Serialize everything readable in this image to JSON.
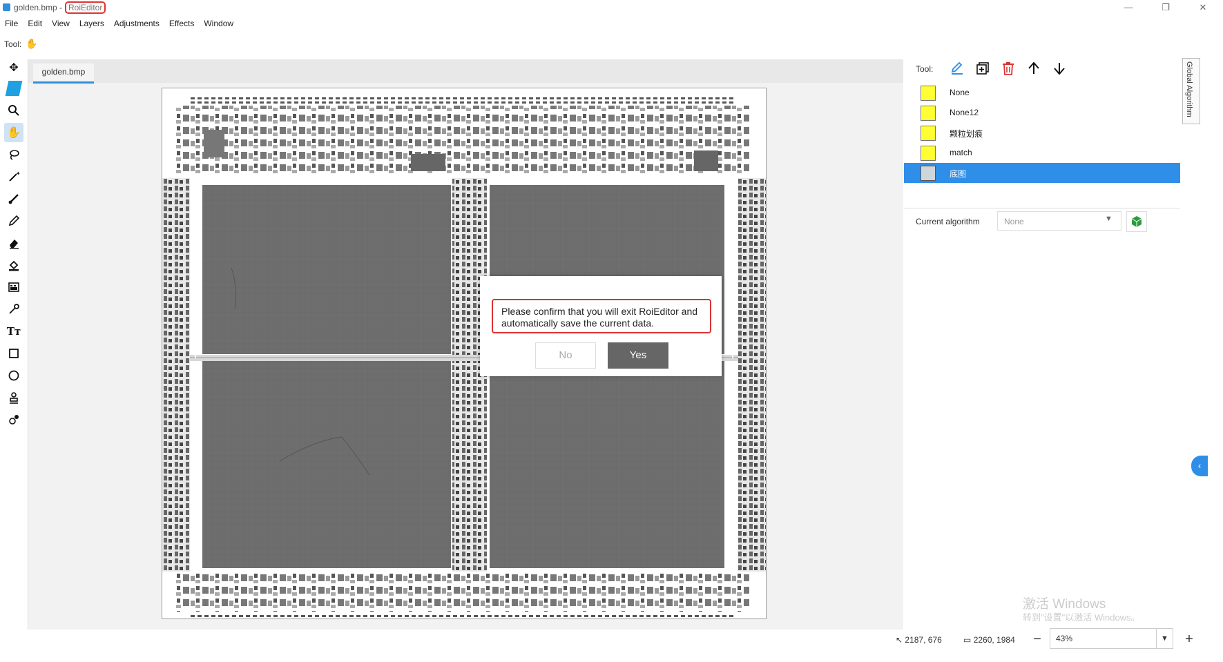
{
  "window": {
    "title_file": "golden.bmp - ",
    "title_app": "RoiEditor",
    "controls": [
      "—",
      "❐",
      "✕"
    ]
  },
  "menu": [
    "File",
    "Edit",
    "View",
    "Layers",
    "Adjustments",
    "Effects",
    "Window"
  ],
  "toolrow": {
    "label": "Tool:",
    "icon": "hand-icon"
  },
  "left_tools": [
    "move-icon",
    "select-icon",
    "zoom-icon",
    "hand-icon",
    "lasso-icon",
    "magic-wand-icon",
    "brush-icon",
    "pencil-icon",
    "eraser-icon",
    "fill-icon",
    "gradient-icon",
    "eyedropper-icon",
    "text-icon",
    "rectangle-icon",
    "ellipse-icon",
    "stamp-icon",
    "clone-icon"
  ],
  "document": {
    "tab_label": "golden.bmp"
  },
  "dialog": {
    "message": "Please confirm that you will exit RoiEditor and automatically save the current data.",
    "no_label": "No",
    "yes_label": "Yes"
  },
  "layers_panel": {
    "tool_label": "Tool:",
    "tool_icons": [
      "edit-icon",
      "add-layer-icon",
      "delete-icon",
      "move-up-icon",
      "move-down-icon"
    ],
    "layers": [
      {
        "name": "None",
        "selected": false
      },
      {
        "name": "None12",
        "selected": false
      },
      {
        "name": "颗粒划痕",
        "selected": false
      },
      {
        "name": "match",
        "selected": false
      },
      {
        "name": "底图",
        "selected": true
      }
    ],
    "algo_label": "Current algorithm",
    "algo_value": "None"
  },
  "global_tab_label": "Global Algorithm",
  "watermark": {
    "line1": "激活 Windows",
    "line2": "转到\"设置\"以激活 Windows。"
  },
  "status": {
    "cursor_pos": "2187, 676",
    "image_size": "2260, 1984",
    "zoom": "43%"
  },
  "colors": {
    "accent": "#2f8fe8",
    "layer_swatch": "#ffff33",
    "dialog_highlight": "#dd3333",
    "yes_button": "#666666"
  }
}
